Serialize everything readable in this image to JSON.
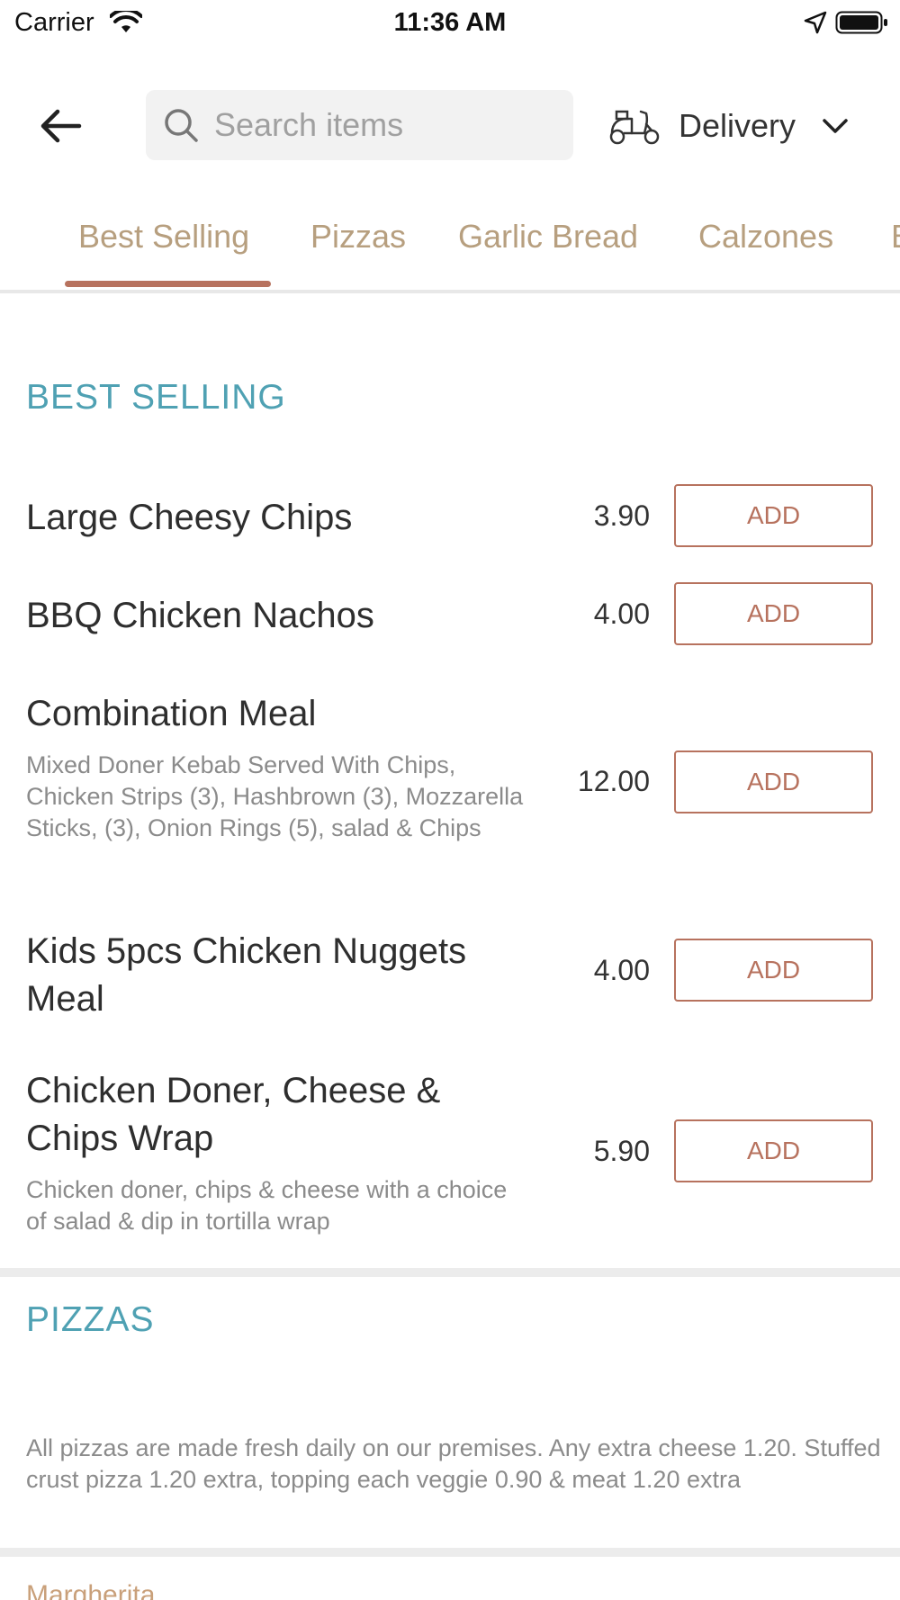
{
  "status_bar": {
    "carrier": "Carrier",
    "time": "11:36 AM",
    "icons": [
      "wifi-icon",
      "location-arrow-icon",
      "battery-icon"
    ]
  },
  "header": {
    "back_icon": "back-arrow-icon",
    "search": {
      "placeholder": "Search items",
      "value": "",
      "icon": "search-icon"
    },
    "delivery": {
      "icon": "scooter-icon",
      "label": "Delivery",
      "chevron": "chevron-down-icon"
    }
  },
  "tabs": [
    {
      "label": "Best Selling",
      "active": true
    },
    {
      "label": "Pizzas",
      "active": false
    },
    {
      "label": "Garlic Bread",
      "active": false
    },
    {
      "label": "Calzones",
      "active": false
    },
    {
      "label": "B",
      "active": false
    }
  ],
  "sections": {
    "best_selling": {
      "title": "BEST SELLING",
      "items": [
        {
          "name": "Large Cheesy Chips",
          "description": "",
          "price": "3.90",
          "button": "ADD"
        },
        {
          "name": "BBQ Chicken Nachos",
          "description": "",
          "price": "4.00",
          "button": "ADD"
        },
        {
          "name": "Combination Meal",
          "description": "Mixed Doner Kebab Served With Chips, Chicken Strips (3), Hashbrown (3), Mozzarella Sticks, (3), Onion Rings (5), salad & Chips",
          "price": "12.00",
          "button": "ADD"
        },
        {
          "name": "Kids 5pcs Chicken Nuggets Meal",
          "description": "",
          "price": "4.00",
          "button": "ADD"
        },
        {
          "name": "Chicken Doner, Cheese & Chips Wrap",
          "description": "Chicken doner, chips & cheese with a choice of salad & dip in tortilla wrap",
          "price": "5.90",
          "button": "ADD"
        }
      ]
    },
    "pizzas": {
      "title": "PIZZAS",
      "note": "All pizzas are made fresh daily on our premises. Any extra cheese 1.20. Stuffed crust pizza 1.20 extra, topping each veggie 0.90 & meat 1.20 extra",
      "next_item": "Margherita"
    }
  },
  "colors": {
    "accent": "#b7725e",
    "tab_text": "#b79f7f",
    "section_title": "#4fa1b3",
    "muted_text": "#8b8b8b"
  }
}
